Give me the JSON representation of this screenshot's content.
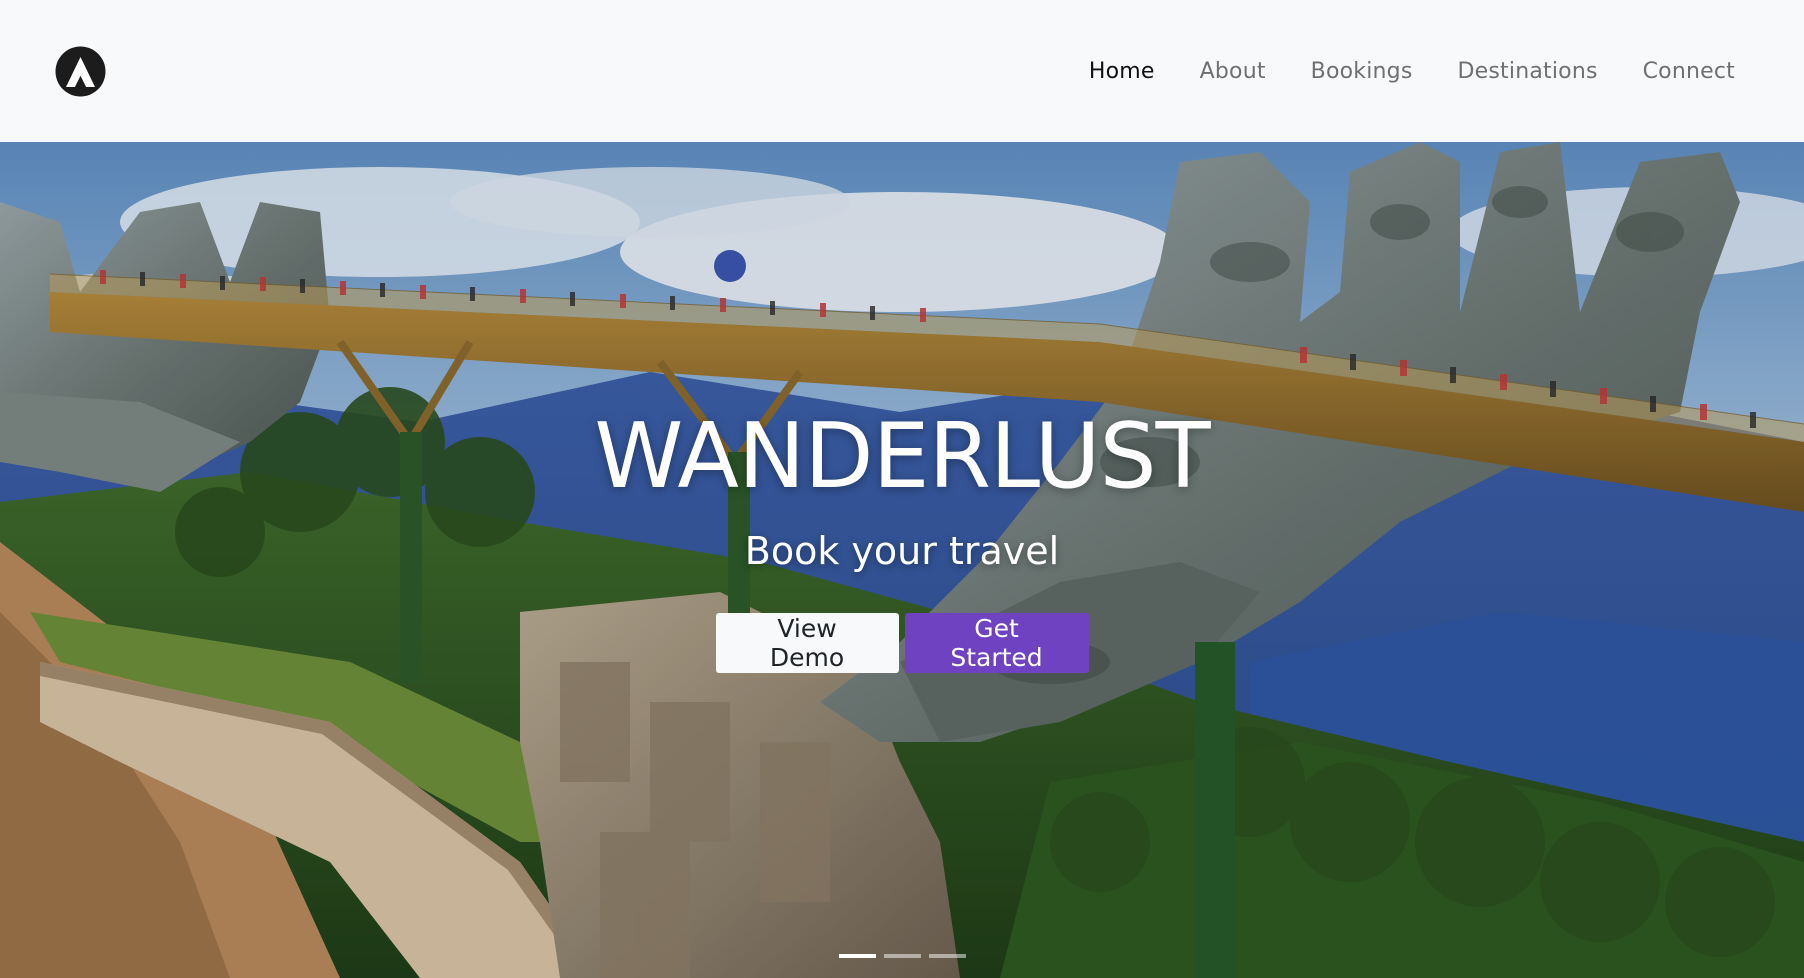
{
  "navbar": {
    "brand_icon": "mountain-logo-icon",
    "links": [
      {
        "label": "Home",
        "active": true
      },
      {
        "label": "About",
        "active": false
      },
      {
        "label": "Bookings",
        "active": false
      },
      {
        "label": "Destinations",
        "active": false
      },
      {
        "label": "Connect",
        "active": false
      }
    ]
  },
  "hero": {
    "title": "WANDERLUST",
    "subtitle": "Book your travel",
    "buttons": {
      "view_demo": "View Demo",
      "get_started": "Get Started"
    },
    "carousel": {
      "slide_count": 3,
      "active_index": 0
    }
  },
  "colors": {
    "nav_background": "#f8f9fa",
    "nav_active": "#111111",
    "nav_inactive": "#707070",
    "primary_button": "#6f42c1",
    "light_button": "#f8f9fa"
  }
}
